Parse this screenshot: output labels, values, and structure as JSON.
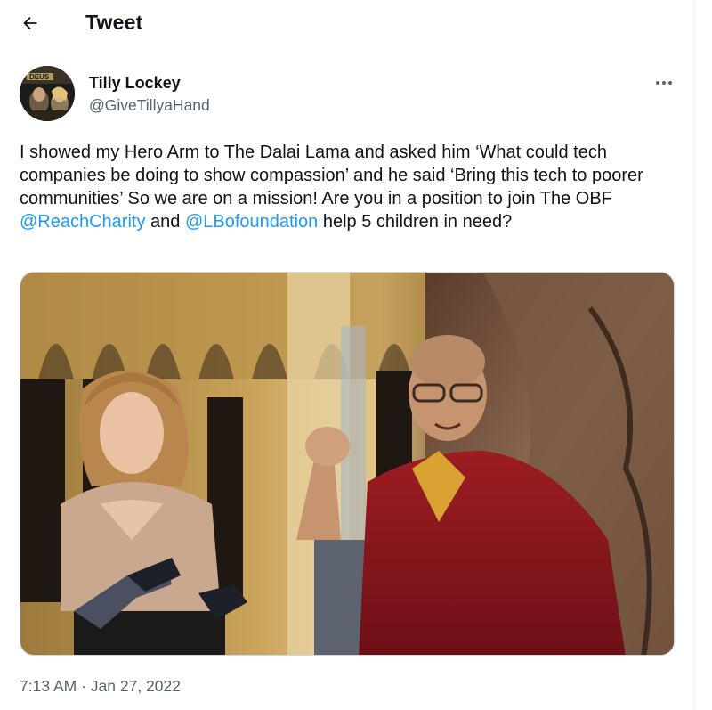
{
  "header": {
    "title": "Tweet",
    "back_icon": "arrow-left-icon"
  },
  "author": {
    "name": "Tilly Lockey",
    "handle": "@GiveTillyaHand",
    "avatar_label": "DEUS"
  },
  "tweet": {
    "text_part1": "I showed my Hero Arm to The Dalai Lama and asked him ‘What could tech companies be doing to show compassion’ and he said ‘Bring this tech to poorer communities’ So we are on a mission! Are you in a position to join The OBF ",
    "mention1": "@ReachCharity",
    "text_part2": " and ",
    "mention2": "@LBofoundation",
    "text_part3": " help 5 children in need?"
  },
  "media": {
    "icon": "photo"
  },
  "meta": {
    "time": "7:13 AM",
    "separator": " · ",
    "date": "Jan 27, 2022"
  },
  "colors": {
    "accent": "#1d9bf0",
    "text": "#0f1419",
    "secondary": "#536471"
  }
}
